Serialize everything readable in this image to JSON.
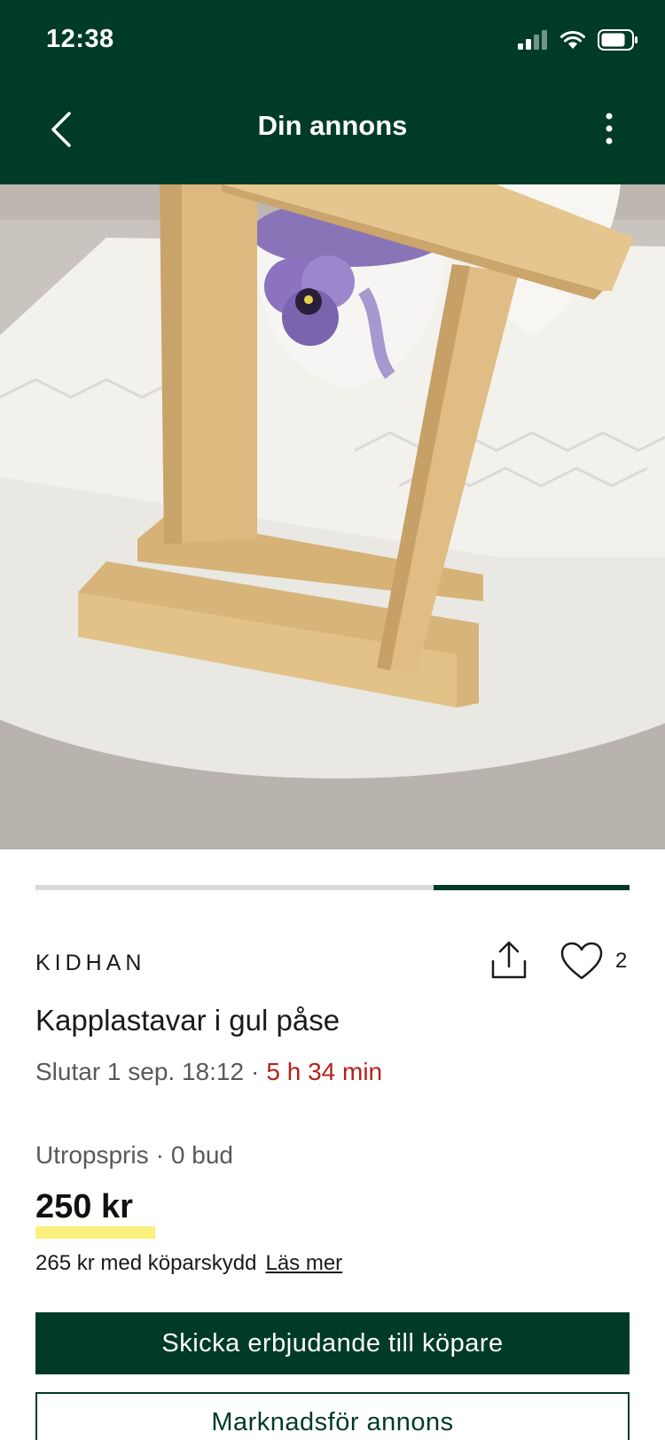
{
  "status_bar": {
    "time": "12:38"
  },
  "header": {
    "title": "Din annons"
  },
  "gallery": {
    "progress": 0.33,
    "photo_description": ""
  },
  "listing": {
    "seller": "KIDHAN",
    "favorites_count": "2",
    "title": "Kapplastavar i gul påse",
    "ends_label": "Slutar 1 sep. 18:12",
    "separator": "·",
    "time_remaining": "5 h 34 min",
    "price_type": "Utropspris",
    "bids": "0 bud",
    "price": "250 kr",
    "protection_text": "265 kr med köparskydd",
    "read_more": "Läs mer"
  },
  "actions": {
    "primary_label": "Skicka erbjudande till köpare",
    "secondary_label": "Marknadsför annons"
  },
  "colors": {
    "brand": "#003b28",
    "accent_red": "#b3221b",
    "highlight": "#fbf17c"
  }
}
